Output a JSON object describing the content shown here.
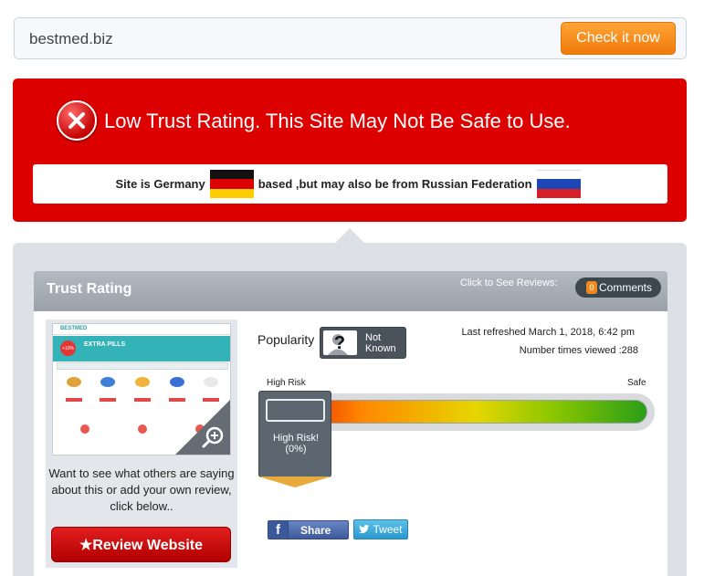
{
  "search": {
    "value": "bestmed.biz",
    "button_label": "Check it now"
  },
  "alert": {
    "title": "Low Trust Rating. This Site May Not Be Safe to Use.",
    "origin_prefix": "Site is Germany",
    "origin_middle": "based ,but may also be from Russian Federation",
    "colors": {
      "background": "#dd0000"
    }
  },
  "trust": {
    "header_title": "Trust Rating",
    "click_to_see": "Click to See Reviews:",
    "comments_count": "0",
    "comments_label": "Comments"
  },
  "thumbnail": {
    "logo_text": "BESTMED",
    "banner_text": "EXTRA PILLS",
    "circle_text": "+10%"
  },
  "review": {
    "prompt": "Want to see what others are saying about this or add your own review, click below..",
    "button_label": "★Review Website"
  },
  "stats": {
    "popularity_label": "Popularity",
    "popularity_value": "Not Known",
    "last_refreshed": "Last refreshed March 1, 2018, 6:42 pm",
    "times_viewed": "Number times viewed :288"
  },
  "meter": {
    "left_label": "High Risk",
    "right_label": "Safe",
    "marker_text": "High Risk!",
    "marker_percent": "(0%)",
    "level": 0
  },
  "social": {
    "share_label": "Share",
    "tweet_label": "Tweet"
  }
}
